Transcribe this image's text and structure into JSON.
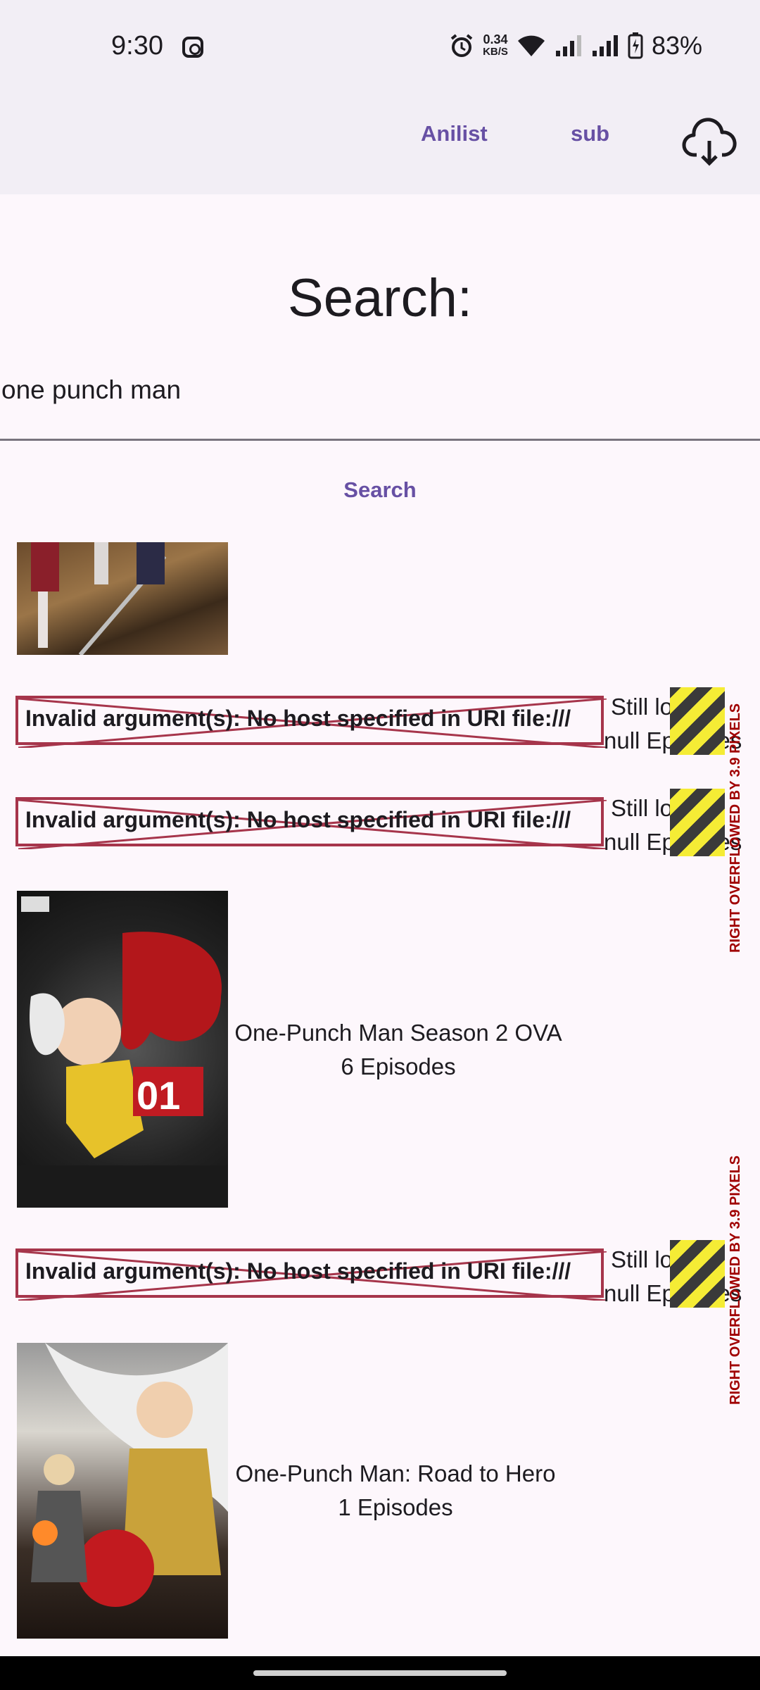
{
  "status_bar": {
    "time": "9:30",
    "net_speed_value": "0.34",
    "net_speed_unit": "KB/S",
    "battery": "83%"
  },
  "app_bar": {
    "anilist_label": "Anilist",
    "sub_label": "sub",
    "download_icon": "cloud-download-icon"
  },
  "search": {
    "title": "Search:",
    "query": "one punch man",
    "button_label": "Search"
  },
  "results": [
    {
      "type": "image",
      "title": "",
      "episodes": ""
    },
    {
      "type": "error",
      "error": "Invalid argument(s): No host specified in URI file:///",
      "line1": "Still loadi",
      "line2": "null Episodes"
    },
    {
      "type": "error",
      "error": "Invalid argument(s): No host specified in URI file:///",
      "line1": "Still loadi",
      "line2": "null Episodes"
    },
    {
      "type": "image",
      "title": "One-Punch Man Season 2 OVA",
      "episodes": "6 Episodes"
    },
    {
      "type": "error",
      "error": "Invalid argument(s): No host specified in URI file:///",
      "line1": "Still loadi",
      "line2": "null Episodes"
    },
    {
      "type": "image",
      "title": "One-Punch Man: Road to Hero",
      "episodes": "1 Episodes"
    }
  ],
  "overflow_warning": "RIGHT OVERFLOWED BY 3.9 PIXELS",
  "colors": {
    "accent": "#6750a4",
    "error_border": "#a6354b",
    "overflow_text": "#a00000",
    "background": "#fdf7fc",
    "bar_background": "#f2eef5"
  }
}
